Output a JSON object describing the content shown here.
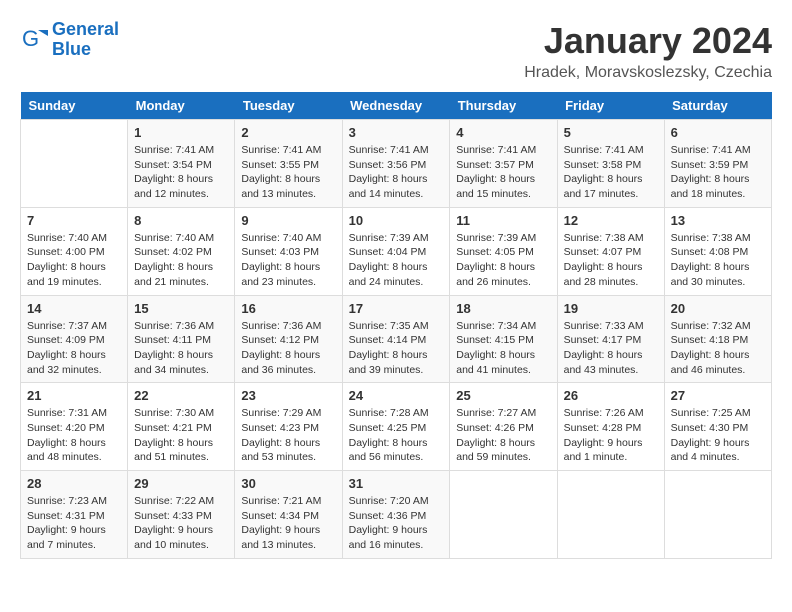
{
  "logo": {
    "text_general": "General",
    "text_blue": "Blue"
  },
  "header": {
    "month_year": "January 2024",
    "location": "Hradek, Moravskoslezsky, Czechia"
  },
  "weekdays": [
    "Sunday",
    "Monday",
    "Tuesday",
    "Wednesday",
    "Thursday",
    "Friday",
    "Saturday"
  ],
  "weeks": [
    [
      {
        "day": "",
        "info": ""
      },
      {
        "day": "1",
        "info": "Sunrise: 7:41 AM\nSunset: 3:54 PM\nDaylight: 8 hours\nand 12 minutes."
      },
      {
        "day": "2",
        "info": "Sunrise: 7:41 AM\nSunset: 3:55 PM\nDaylight: 8 hours\nand 13 minutes."
      },
      {
        "day": "3",
        "info": "Sunrise: 7:41 AM\nSunset: 3:56 PM\nDaylight: 8 hours\nand 14 minutes."
      },
      {
        "day": "4",
        "info": "Sunrise: 7:41 AM\nSunset: 3:57 PM\nDaylight: 8 hours\nand 15 minutes."
      },
      {
        "day": "5",
        "info": "Sunrise: 7:41 AM\nSunset: 3:58 PM\nDaylight: 8 hours\nand 17 minutes."
      },
      {
        "day": "6",
        "info": "Sunrise: 7:41 AM\nSunset: 3:59 PM\nDaylight: 8 hours\nand 18 minutes."
      }
    ],
    [
      {
        "day": "7",
        "info": "Sunrise: 7:40 AM\nSunset: 4:00 PM\nDaylight: 8 hours\nand 19 minutes."
      },
      {
        "day": "8",
        "info": "Sunrise: 7:40 AM\nSunset: 4:02 PM\nDaylight: 8 hours\nand 21 minutes."
      },
      {
        "day": "9",
        "info": "Sunrise: 7:40 AM\nSunset: 4:03 PM\nDaylight: 8 hours\nand 23 minutes."
      },
      {
        "day": "10",
        "info": "Sunrise: 7:39 AM\nSunset: 4:04 PM\nDaylight: 8 hours\nand 24 minutes."
      },
      {
        "day": "11",
        "info": "Sunrise: 7:39 AM\nSunset: 4:05 PM\nDaylight: 8 hours\nand 26 minutes."
      },
      {
        "day": "12",
        "info": "Sunrise: 7:38 AM\nSunset: 4:07 PM\nDaylight: 8 hours\nand 28 minutes."
      },
      {
        "day": "13",
        "info": "Sunrise: 7:38 AM\nSunset: 4:08 PM\nDaylight: 8 hours\nand 30 minutes."
      }
    ],
    [
      {
        "day": "14",
        "info": "Sunrise: 7:37 AM\nSunset: 4:09 PM\nDaylight: 8 hours\nand 32 minutes."
      },
      {
        "day": "15",
        "info": "Sunrise: 7:36 AM\nSunset: 4:11 PM\nDaylight: 8 hours\nand 34 minutes."
      },
      {
        "day": "16",
        "info": "Sunrise: 7:36 AM\nSunset: 4:12 PM\nDaylight: 8 hours\nand 36 minutes."
      },
      {
        "day": "17",
        "info": "Sunrise: 7:35 AM\nSunset: 4:14 PM\nDaylight: 8 hours\nand 39 minutes."
      },
      {
        "day": "18",
        "info": "Sunrise: 7:34 AM\nSunset: 4:15 PM\nDaylight: 8 hours\nand 41 minutes."
      },
      {
        "day": "19",
        "info": "Sunrise: 7:33 AM\nSunset: 4:17 PM\nDaylight: 8 hours\nand 43 minutes."
      },
      {
        "day": "20",
        "info": "Sunrise: 7:32 AM\nSunset: 4:18 PM\nDaylight: 8 hours\nand 46 minutes."
      }
    ],
    [
      {
        "day": "21",
        "info": "Sunrise: 7:31 AM\nSunset: 4:20 PM\nDaylight: 8 hours\nand 48 minutes."
      },
      {
        "day": "22",
        "info": "Sunrise: 7:30 AM\nSunset: 4:21 PM\nDaylight: 8 hours\nand 51 minutes."
      },
      {
        "day": "23",
        "info": "Sunrise: 7:29 AM\nSunset: 4:23 PM\nDaylight: 8 hours\nand 53 minutes."
      },
      {
        "day": "24",
        "info": "Sunrise: 7:28 AM\nSunset: 4:25 PM\nDaylight: 8 hours\nand 56 minutes."
      },
      {
        "day": "25",
        "info": "Sunrise: 7:27 AM\nSunset: 4:26 PM\nDaylight: 8 hours\nand 59 minutes."
      },
      {
        "day": "26",
        "info": "Sunrise: 7:26 AM\nSunset: 4:28 PM\nDaylight: 9 hours\nand 1 minute."
      },
      {
        "day": "27",
        "info": "Sunrise: 7:25 AM\nSunset: 4:30 PM\nDaylight: 9 hours\nand 4 minutes."
      }
    ],
    [
      {
        "day": "28",
        "info": "Sunrise: 7:23 AM\nSunset: 4:31 PM\nDaylight: 9 hours\nand 7 minutes."
      },
      {
        "day": "29",
        "info": "Sunrise: 7:22 AM\nSunset: 4:33 PM\nDaylight: 9 hours\nand 10 minutes."
      },
      {
        "day": "30",
        "info": "Sunrise: 7:21 AM\nSunset: 4:34 PM\nDaylight: 9 hours\nand 13 minutes."
      },
      {
        "day": "31",
        "info": "Sunrise: 7:20 AM\nSunset: 4:36 PM\nDaylight: 9 hours\nand 16 minutes."
      },
      {
        "day": "",
        "info": ""
      },
      {
        "day": "",
        "info": ""
      },
      {
        "day": "",
        "info": ""
      }
    ]
  ]
}
